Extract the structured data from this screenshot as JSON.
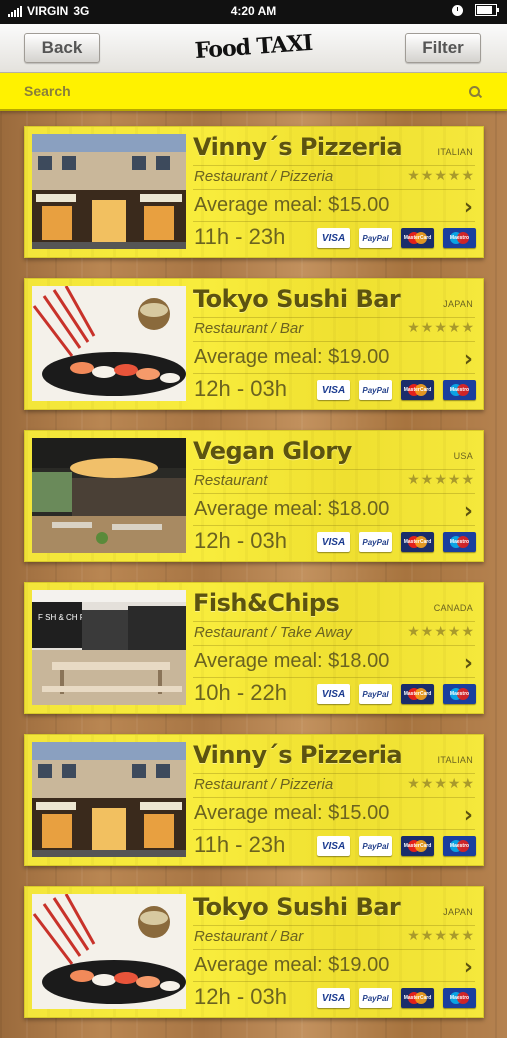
{
  "status": {
    "carrier": "VIRGIN",
    "network": "3G",
    "time": "4:20 AM"
  },
  "nav": {
    "back_label": "Back",
    "logo_text": "Food TAXI",
    "filter_label": "Filter"
  },
  "search": {
    "placeholder": "Search"
  },
  "restaurants": [
    {
      "name": "Vinny´s Pizzeria",
      "country": "ITALIAN",
      "type": "Restaurant / Pizzeria",
      "rating": 5,
      "stars": "★★★★★",
      "average": "Average meal: $15.00",
      "hours": "11h - 23h",
      "image": "pizzeria"
    },
    {
      "name": "Tokyo Sushi Bar",
      "country": "JAPAN",
      "type": "Restaurant / Bar",
      "rating": 5,
      "stars": "★★★★★",
      "average": "Average meal: $19.00",
      "hours": "12h - 03h",
      "image": "sushi"
    },
    {
      "name": "Vegan Glory",
      "country": "USA",
      "type": "Restaurant",
      "rating": 5,
      "stars": "★★★★★",
      "average": "Average meal: $18.00",
      "hours": "12h - 03h",
      "image": "vegan"
    },
    {
      "name": "Fish&Chips",
      "country": "CANADA",
      "type": "Restaurant / Take Away",
      "rating": 5,
      "stars": "★★★★★",
      "average": "Average meal: $18.00",
      "hours": "10h - 22h",
      "image": "fishchips"
    },
    {
      "name": "Vinny´s Pizzeria",
      "country": "ITALIAN",
      "type": "Restaurant / Pizzeria",
      "rating": 5,
      "stars": "★★★★★",
      "average": "Average meal: $15.00",
      "hours": "11h - 23h",
      "image": "pizzeria"
    },
    {
      "name": "Tokyo Sushi Bar",
      "country": "JAPAN",
      "type": "Restaurant / Bar",
      "rating": 5,
      "stars": "★★★★★",
      "average": "Average meal: $19.00",
      "hours": "12h - 03h",
      "image": "sushi"
    }
  ],
  "payments": [
    "VISA",
    "PayPal",
    "MasterCard",
    "Maestro"
  ],
  "colors": {
    "card": "#f5e83c",
    "searchbar": "#fff200",
    "text": "#6b6320",
    "title": "#5c5310"
  }
}
